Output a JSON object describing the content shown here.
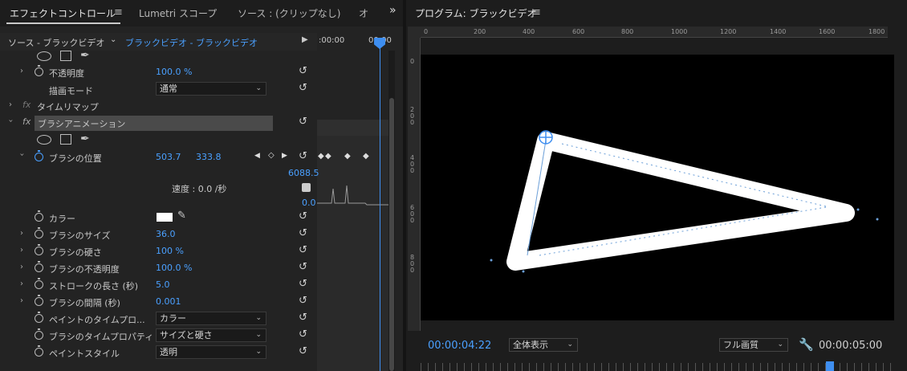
{
  "left_tabs": {
    "effect_controls": "エフェクトコントロール",
    "menu_icon": "≡",
    "lumetri_scopes": "Lumetri スコープ",
    "source": "ソース : (クリップなし)",
    "overflow": "オ",
    "expand": "»"
  },
  "source_row": {
    "source": "ソース - ブラックビデオ",
    "clip": "ブラックビデオ - ブラックビデオ",
    "time_start": ":00:00",
    "time_end": "00:00"
  },
  "opacity": {
    "label": "不透明度",
    "value": "100.0 %",
    "blend_label": "描画モード",
    "blend_value": "通常"
  },
  "time_remap": {
    "label": "タイムリマップ"
  },
  "brush_anim": {
    "label": "ブラシアニメーション"
  },
  "brush_position": {
    "label": "ブラシの位置",
    "x": "503.7",
    "y": "333.8",
    "graph_max": "6088.5",
    "speed": "速度 : 0.0 /秒",
    "graph_min": "0.0"
  },
  "properties": [
    {
      "label": "カラー",
      "color": "#ffffff"
    },
    {
      "label": "ブラシのサイズ",
      "value": "36.0"
    },
    {
      "label": "ブラシの硬さ",
      "value": "100 %"
    },
    {
      "label": "ブラシの不透明度",
      "value": "100.0 %"
    },
    {
      "label": "ストロークの長さ (秒)",
      "value": "5.0"
    },
    {
      "label": "ブラシの間隔 (秒)",
      "value": "0.001"
    },
    {
      "label": "ペイントのタイムプロ...",
      "value": "カラー"
    },
    {
      "label": "ブラシのタイムプロパティ",
      "value": "サイズと硬さ"
    },
    {
      "label": "ペイントスタイル",
      "value": "透明"
    }
  ],
  "program": {
    "title": "プログラム: ブラックビデオ",
    "menu_icon": "≡",
    "ruler_h": [
      "0",
      "200",
      "400",
      "600",
      "800",
      "1000",
      "1200",
      "1400",
      "1600",
      "1800"
    ],
    "ruler_v": [
      "0",
      "2\n0\n0",
      "4\n0\n0",
      "6\n0\n0",
      "8\n0\n0"
    ],
    "timecode_current": "00:00:04:22",
    "zoom": "全体表示",
    "quality": "フル画質",
    "timecode_duration": "00:00:05:00",
    "wrench_icon": "wrench-icon"
  },
  "colors": {
    "accent": "#4aa0ff",
    "playhead": "#3e8ef0"
  }
}
